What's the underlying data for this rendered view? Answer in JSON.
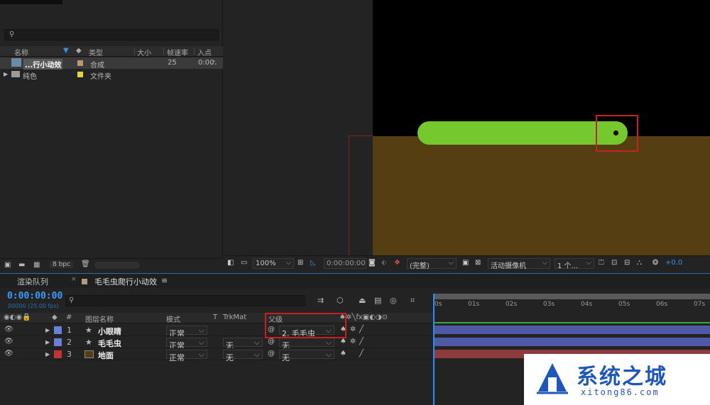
{
  "project": {
    "columns": {
      "name": "名称",
      "type": "类型",
      "size": "大小",
      "fps": "帧速率",
      "in": "入点"
    },
    "items": [
      {
        "name": "...行小动效",
        "type": "合成",
        "fps": "25",
        "in": "0:00",
        "color": "#b59a7a"
      },
      {
        "name": "纯色",
        "type": "文件夹",
        "fps": "",
        "in": "",
        "color": "#e6d43c"
      }
    ],
    "footer_bpc": "8 bpc"
  },
  "viewer": {
    "zoom": "100%",
    "timecode": "0:00:00:00",
    "resolution": "(完整)",
    "camera": "活动摄像机",
    "views": "1 个...",
    "exposure": "+0.0"
  },
  "timeline": {
    "tab_render": "渲染队列",
    "tab_comp": "毛毛虫爬行小动效",
    "timecode": "0:00:00:00",
    "fps": "00000 (25.00 fps)",
    "headers": {
      "num": "#",
      "name": "图层名称",
      "mode": "模式",
      "t": "T",
      "trkmat": "TrkMat",
      "parent": "父级"
    },
    "layers": [
      {
        "num": "1",
        "name": "小眼睛",
        "mode": "正常",
        "trkmat": "",
        "parent": "2. 毛毛虫",
        "color": "#6b7fd6",
        "bar": "#4e5aa6"
      },
      {
        "num": "2",
        "name": "毛毛虫",
        "mode": "正常",
        "trkmat": "无",
        "parent": "无",
        "color": "#6b7fd6",
        "bar": "#4e5aa6"
      },
      {
        "num": "3",
        "name": "地面",
        "mode": "正常",
        "trkmat": "无",
        "parent": "无",
        "color": "#c43434",
        "bar": "#8e3b3b"
      }
    ],
    "ruler": [
      "0s",
      "01s",
      "02s",
      "03s",
      "04s",
      "05s",
      "06s",
      "07s"
    ]
  },
  "watermark": {
    "title": "系统之城",
    "url": "xitong86.com"
  }
}
